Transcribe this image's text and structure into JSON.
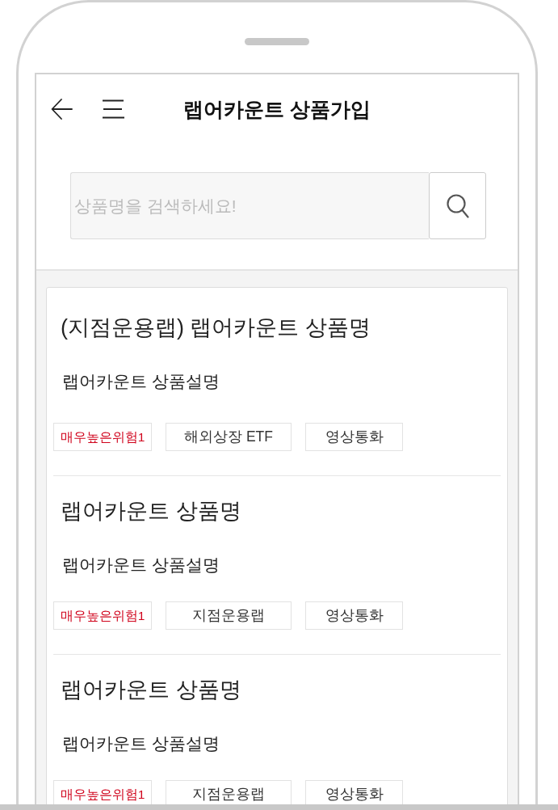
{
  "header": {
    "title": "랩어카운트 상품가입"
  },
  "search": {
    "placeholder": "상품명을 검색하세요!"
  },
  "products": [
    {
      "name": "(지점운용랩) 랩어카운트 상품명",
      "description": "랩어카운트 상품설명",
      "tags": [
        {
          "label": "매우높은위험1",
          "kind": "risk"
        },
        {
          "label": "해외상장 ETF",
          "kind": "category"
        },
        {
          "label": "영상통화",
          "kind": "category"
        }
      ]
    },
    {
      "name": "랩어카운트 상품명",
      "description": "랩어카운트 상품설명",
      "tags": [
        {
          "label": "매우높은위험1",
          "kind": "risk"
        },
        {
          "label": "지점운용랩",
          "kind": "category"
        },
        {
          "label": "영상통화",
          "kind": "category"
        }
      ]
    },
    {
      "name": "랩어카운트 상품명",
      "description": "랩어카운트 상품설명",
      "tags": [
        {
          "label": "매우높은위험1",
          "kind": "risk"
        },
        {
          "label": "지점운용랩",
          "kind": "category"
        },
        {
          "label": "영상통화",
          "kind": "category"
        }
      ]
    }
  ]
}
